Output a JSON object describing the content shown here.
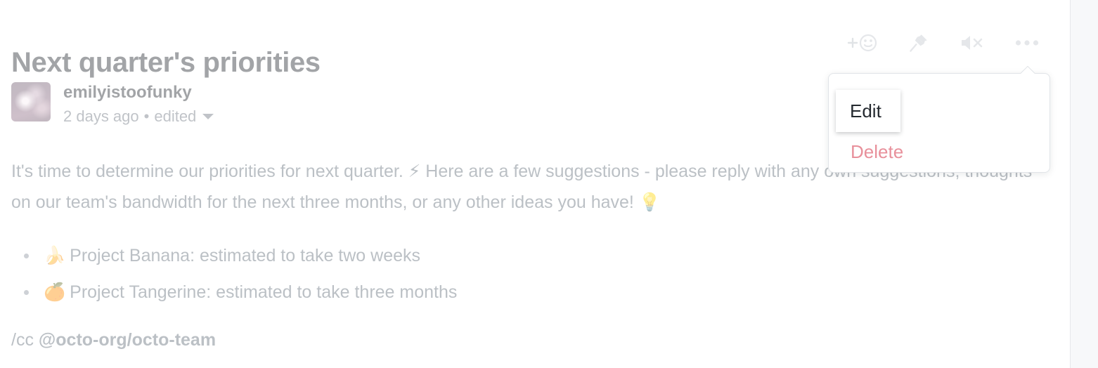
{
  "page": {
    "title": "Next quarter's priorities"
  },
  "toolbar": {
    "items": [
      {
        "name": "add-reaction-icon",
        "label": "Add reaction"
      },
      {
        "name": "pin-icon",
        "label": "Pin issue"
      },
      {
        "name": "mute-icon",
        "label": "Unsubscribe"
      },
      {
        "name": "kebab-menu-icon",
        "label": "Show options"
      }
    ]
  },
  "comment": {
    "author": "emilyistoofunky",
    "timestamp": "2 days ago",
    "separator": "•",
    "edited_label": "edited",
    "paragraph_part1": "It's time to determine our priorities for next quarter.",
    "emoji_zap": "⚡",
    "paragraph_part2": "Here are a few suggestions - please reply with any own suggestions, thoughts on our team's bandwidth for the next three months, or any other ideas you have!",
    "emoji_bulb": "💡",
    "line1_visible": "It's time to determine our priorities for next quarter.",
    "line1_after_emoji": "Here are a few suggestions - please reply with any",
    "line2": "own suggestions, thoughts on our team's bandwidth for the next three months, or any other ideas you have!",
    "bullets": [
      {
        "emoji": "🍌",
        "text": "Project Banana: estimated to take two weeks"
      },
      {
        "emoji": "🍊",
        "text": "Project Tangerine: estimated to take three months"
      }
    ],
    "cc_prefix": "/cc ",
    "cc_mention": "@octo-org/octo-team"
  },
  "menu": {
    "edit_label": "Edit",
    "delete_label": "Delete",
    "delete_color": "#e8909b",
    "edit_color": "#24292f"
  }
}
